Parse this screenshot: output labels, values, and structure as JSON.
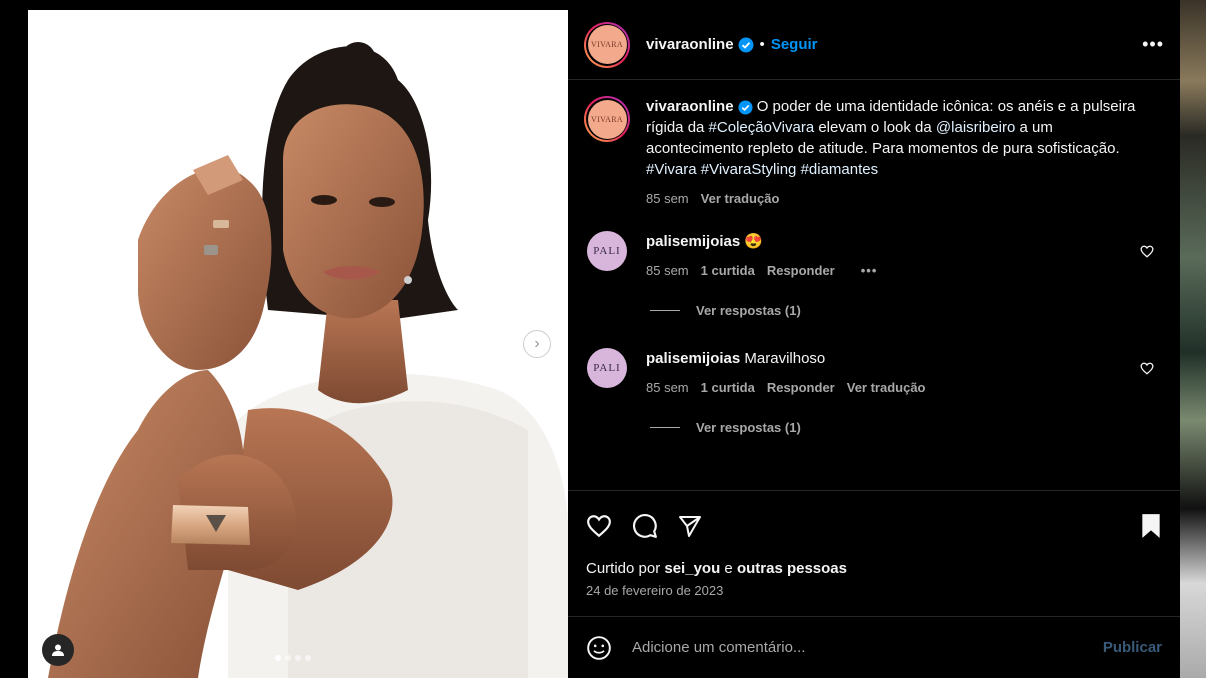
{
  "post": {
    "account": "vivaraonline",
    "avatar_text": "VIVARA",
    "separator": "•",
    "follow_label": "Seguir",
    "more_label": "•••",
    "carousel": {
      "slides": 4,
      "current": 1,
      "next_label": "›"
    }
  },
  "caption": {
    "user": "vivaraonline",
    "text_1": "O poder de uma identidade icônica: os anéis e a pulseira rígida da ",
    "tag_1": "#ColeçãoVivara",
    "text_2": " elevam o look da ",
    "mention": "@laisribeiro",
    "text_3": " a um acontecimento repleto de atitude. Para momentos de pura sofisticação. ",
    "tag_2": "#Vivara",
    "tag_3": "#VivaraStyling",
    "tag_4": "#diamantes",
    "age": "85 sem",
    "translate": "Ver tradução"
  },
  "comments": [
    {
      "user": "palisemijoias",
      "avatar_text": "PALI",
      "text": "😍",
      "age": "85 sem",
      "likes": "1 curtida",
      "reply": "Responder",
      "extra": "•••",
      "replies": "Ver respostas (1)"
    },
    {
      "user": "palisemijoias",
      "avatar_text": "PALI",
      "text": "Maravilhoso",
      "age": "85 sem",
      "likes": "1 curtida",
      "reply": "Responder",
      "extra": "Ver tradução",
      "replies": "Ver respostas (1)"
    }
  ],
  "likes": {
    "prefix": "Curtido por ",
    "user": "sei_you",
    "mid": " e ",
    "rest": "outras pessoas"
  },
  "date": "24 de fevereiro de 2023",
  "add_comment": {
    "placeholder": "Adicione um comentário...",
    "publish": "Publicar"
  },
  "colors": {
    "follow": "#0095f6",
    "verified": "#0095f6",
    "background": "#000000"
  }
}
